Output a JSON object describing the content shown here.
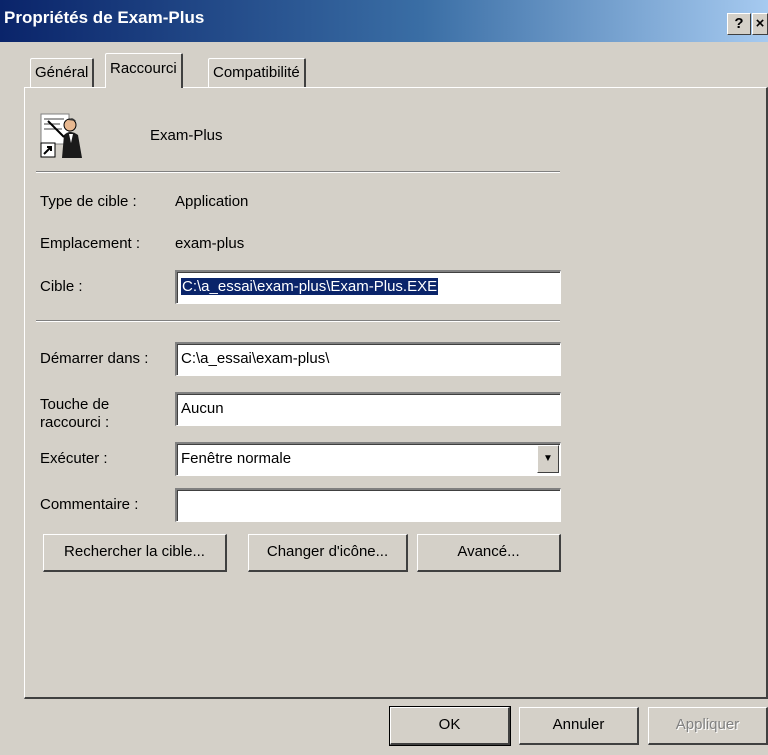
{
  "window": {
    "title": "Propriétés de Exam-Plus",
    "help_label": "?",
    "close_label": "×"
  },
  "tabs": [
    {
      "label": "Général"
    },
    {
      "label": "Raccourci"
    },
    {
      "label": "Compatibilité"
    }
  ],
  "shortcut": {
    "name": "Exam-Plus",
    "type_label": "Type de cible :",
    "type_value": "Application",
    "location_label": "Emplacement :",
    "location_value": "exam-plus",
    "target_label": "Cible :",
    "target_value": "C:\\a_essai\\exam-plus\\Exam-Plus.EXE",
    "start_in_label": "Démarrer dans :",
    "start_in_value": "C:\\a_essai\\exam-plus\\",
    "hotkey_label_1": "Touche de",
    "hotkey_label_2": "raccourci :",
    "hotkey_value": "Aucun",
    "run_label": "Exécuter :",
    "run_value": "Fenêtre normale",
    "comment_label": "Commentaire :",
    "comment_value": ""
  },
  "buttons": {
    "find_target": "Rechercher la cible...",
    "change_icon": "Changer d'icône...",
    "advanced": "Avancé..."
  },
  "footer": {
    "ok": "OK",
    "cancel": "Annuler",
    "apply": "Appliquer"
  },
  "colors": {
    "titlebar_start": "#0a246a",
    "titlebar_end": "#a6caf0",
    "face": "#d4d0c8",
    "selection": "#0a246a"
  },
  "icons": {
    "shortcut_icon": "teacher-with-pointer-icon",
    "dropdown": "chevron-down-icon"
  }
}
